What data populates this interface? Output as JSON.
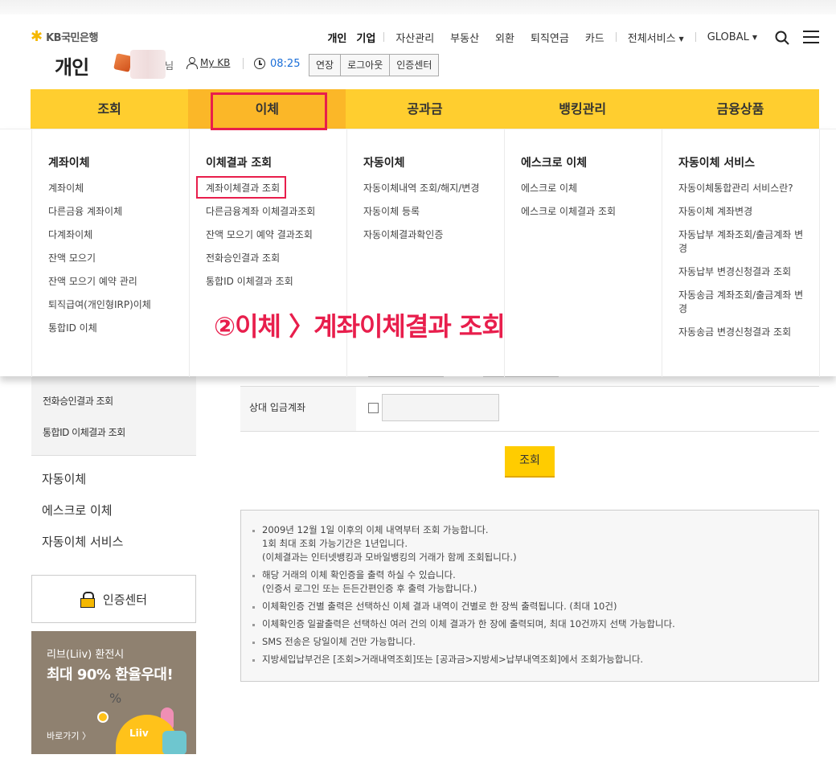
{
  "logo": {
    "text": "KB국민은행"
  },
  "topnav": {
    "personal": "개인",
    "business": "기업",
    "items": [
      "자산관리",
      "부동산",
      "외환",
      "퇴직연금",
      "카드"
    ],
    "all_services": "전체서비스",
    "global": "GLOBAL"
  },
  "header": {
    "title": "개인",
    "user_suffix": "님",
    "mykb": "My KB",
    "timer": "08:25",
    "extend": "연장",
    "logout": "로그아웃",
    "cert_center": "인증센터"
  },
  "mainnav": [
    "조회",
    "이체",
    "공과금",
    "뱅킹관리",
    "금융상품"
  ],
  "dropdown": [
    {
      "title": "계좌이체",
      "links": [
        "계좌이체",
        "다른금융 계좌이체",
        "다계좌이체",
        "잔액 모으기",
        "잔액 모으기 예약 관리",
        "퇴직급여(개인형IRP)이체",
        "통합ID 이체"
      ]
    },
    {
      "title": "이체결과 조회",
      "links": [
        "계좌이체결과 조회",
        "다른금융계좌 이체결과조회",
        "잔액 모으기 예약 결과조회",
        "전화승인결과 조회",
        "통합ID 이체결과 조회"
      ]
    },
    {
      "title": "자동이체",
      "links": [
        "자동이체내역 조회/해지/변경",
        "자동이체 등록",
        "자동이체결과확인증"
      ]
    },
    {
      "title": "에스크로 이체",
      "links": [
        "에스크로 이체",
        "에스크로 이체결과 조회"
      ]
    },
    {
      "title": "자동이체 서비스",
      "links": [
        "자동이체통합관리 서비스란?",
        "자동이체 계좌변경",
        "자동납부 계좌조회/출금계좌 변경",
        "자동납부 변경신청결과 조회",
        "자동송금 계좌조회/출금계좌 변경",
        "자동송금 변경신청결과 조회"
      ]
    }
  ],
  "annotation": "②이체 〉계좌이체결과 조회",
  "sidebar": {
    "sub_items": [
      "전화승인결과 조회",
      "통합ID 이체결과 조회"
    ],
    "main_items": [
      "자동이체",
      "에스크로 이체",
      "자동이체 서비스"
    ],
    "cert_center": "인증센터",
    "banner": {
      "line1": "리브(Liiv) 환전시",
      "line2": "최대 90% 환율우대!",
      "link": "바로가기 〉",
      "mark": "Liiv"
    }
  },
  "form": {
    "label": "상대 입금계좌",
    "search_button": "조회"
  },
  "notices": [
    "2009년 12월 1일 이후의 이체 내역부터 조회 가능합니다.",
    "1회 최대 조회 가능기간은 1년입니다.",
    "(이체결과는 인터넷뱅킹과 모바일뱅킹의 거래가 함께 조회됩니다.)",
    "해당 거래의 이체 확인증을 출력 하실 수 있습니다.",
    "(인증서 로그인 또는 든든간편인증 후 출력 가능합니다.)",
    "이체확인증 건별 출력은 선택하신 이체 결과 내역이 건별로 한 장씩 출력됩니다. (최대 10건)",
    "이체확인증 일괄출력은 선택하신 여러 건의 이체 결과가 한 장에 출력되며, 최대 10건까지 선택 가능합니다.",
    "SMS 전송은 당일이체 건만 가능합니다.",
    "지방세입납부건은 [조회>거래내역조회]또는 [공과금>지방세>납부내역조회]에서 조회가능합니다."
  ],
  "colors": {
    "brand_yellow": "#ffce2f",
    "active_yellow": "#fbb728",
    "highlight_red": "#e81e4c",
    "timer_blue": "#1a6ed8"
  }
}
